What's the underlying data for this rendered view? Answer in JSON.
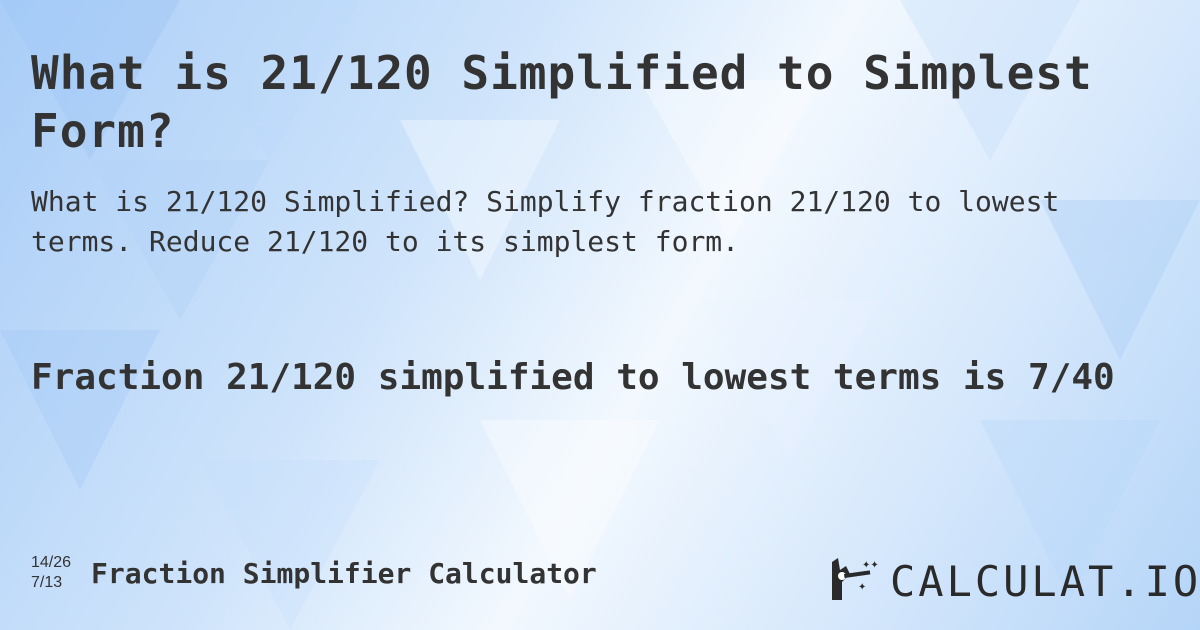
{
  "page": {
    "title": "What is 21/120 Simplified to Simplest Form?",
    "subtitle": "What is 21/120 Simplified? Simplify fraction 21/120 to lowest terms. Reduce 21/120 to its simplest form.",
    "answer": "Fraction 21/120 simplified to lowest terms is 7/40"
  },
  "footer": {
    "mini_fraction_top": "14/26",
    "mini_fraction_bottom": "7/13",
    "calculator_name": "Fraction Simplifier Calculator",
    "logo_icon": "magic-wand-hand-icon",
    "logo_text": "CALCULAT.IO"
  },
  "colors": {
    "text": "#333333",
    "bg_light": "#f2f8fe",
    "bg_blue": "#a9cdf7"
  }
}
